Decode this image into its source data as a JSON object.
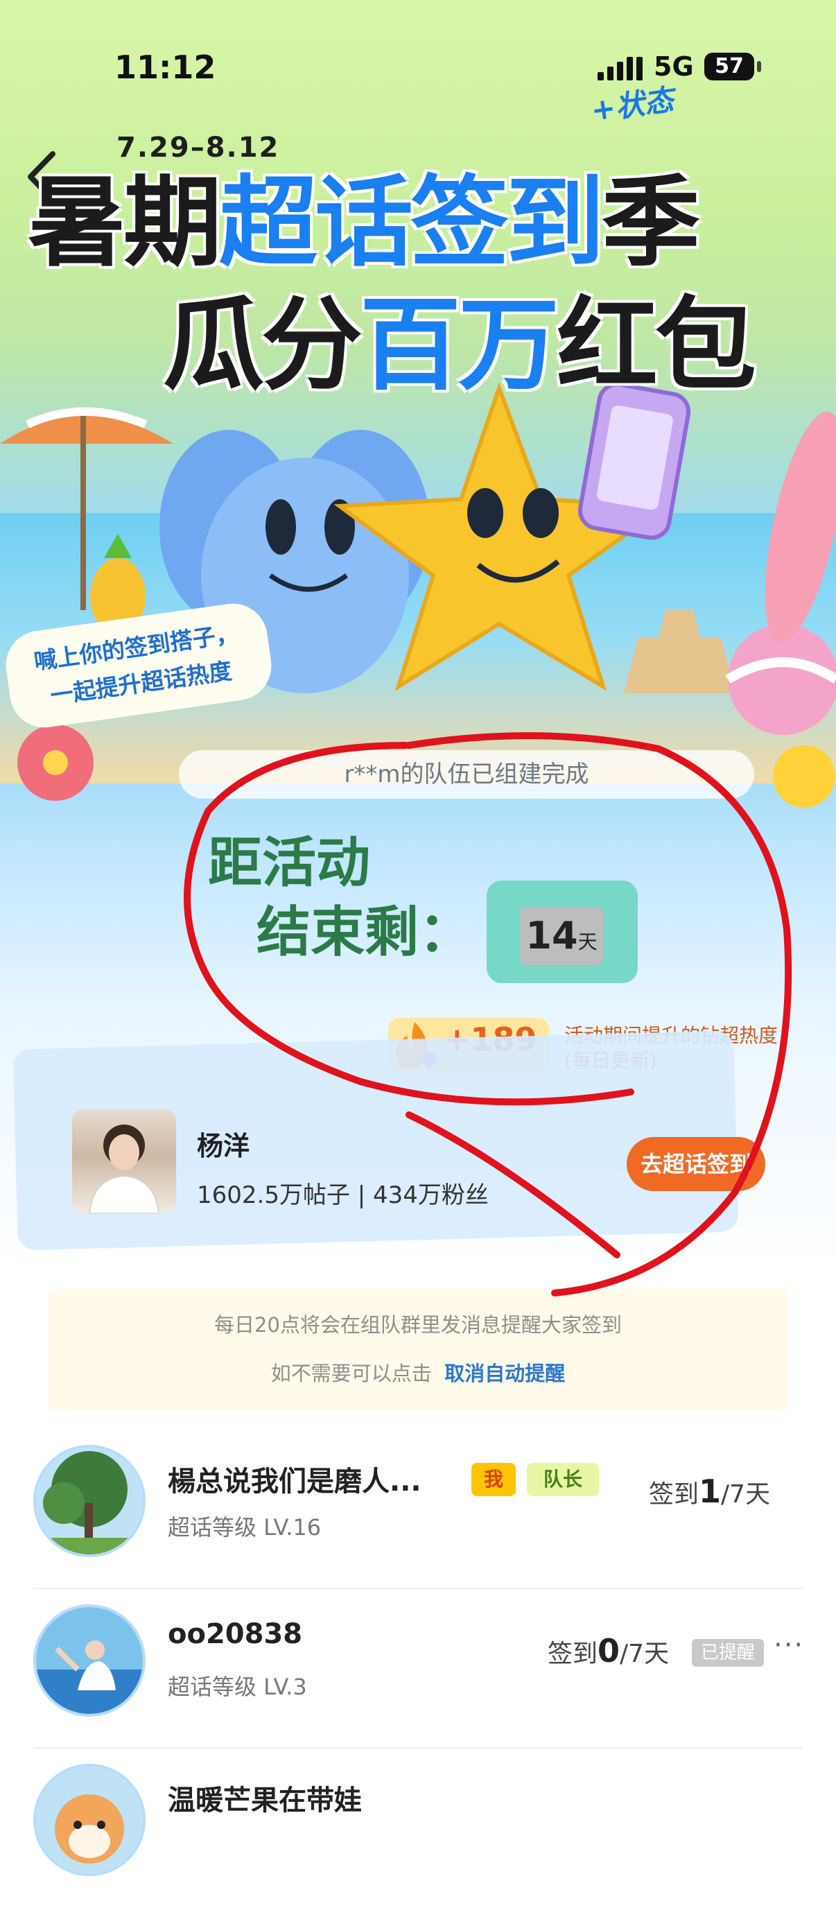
{
  "status_bar": {
    "time": "11:12",
    "network": "5G",
    "battery": "57"
  },
  "hero": {
    "date_range": "7.29–8.12",
    "state_badge": "+状态",
    "title_line1_a": "暑期",
    "title_line1_b": "超话签到",
    "title_line1_c": "季",
    "title_line2_a": "瓜分",
    "title_line2_b": "百万",
    "title_line2_c": "红包",
    "tagline_1": "喊上你的签到搭子，",
    "tagline_2": "一起提升超话热度"
  },
  "team_banner": "r**m的队伍已组建完成",
  "countdown": {
    "label_1": "距活动",
    "label_2": "结束剩：",
    "days": "14",
    "unit": "天"
  },
  "heat": {
    "value": "+189",
    "desc_1": "活动期间提升的钻超热度",
    "desc_2": "(每日更新)"
  },
  "supertopic": {
    "name": "杨洋",
    "stats": "1602.5万帖子 | 434万粉丝",
    "signin_button": "去超话签到"
  },
  "notice": {
    "line1": "每日20点将会在组队群里发消息提醒大家签到",
    "line2_prefix": "如不需要可以点击",
    "line2_link": "取消自动提醒"
  },
  "members": [
    {
      "name": "楊总说我们是磨人...",
      "level": "超话等级 LV.16",
      "tag_me": "我",
      "tag_captain": "队长",
      "signin_prefix": "签到",
      "signin_days": "1",
      "signin_total": "/7天"
    },
    {
      "name": "oo20838",
      "level": "超话等级 LV.3",
      "signin_prefix": "签到",
      "signin_days": "0",
      "signin_total": "/7天",
      "reminded": "已提醒",
      "more": "···"
    },
    {
      "name": "温暖芒果在带娃"
    }
  ],
  "colors": {
    "accent_blue": "#1a7ff0",
    "signin_orange": "#f06a25",
    "annotation_red": "#e0121c"
  }
}
